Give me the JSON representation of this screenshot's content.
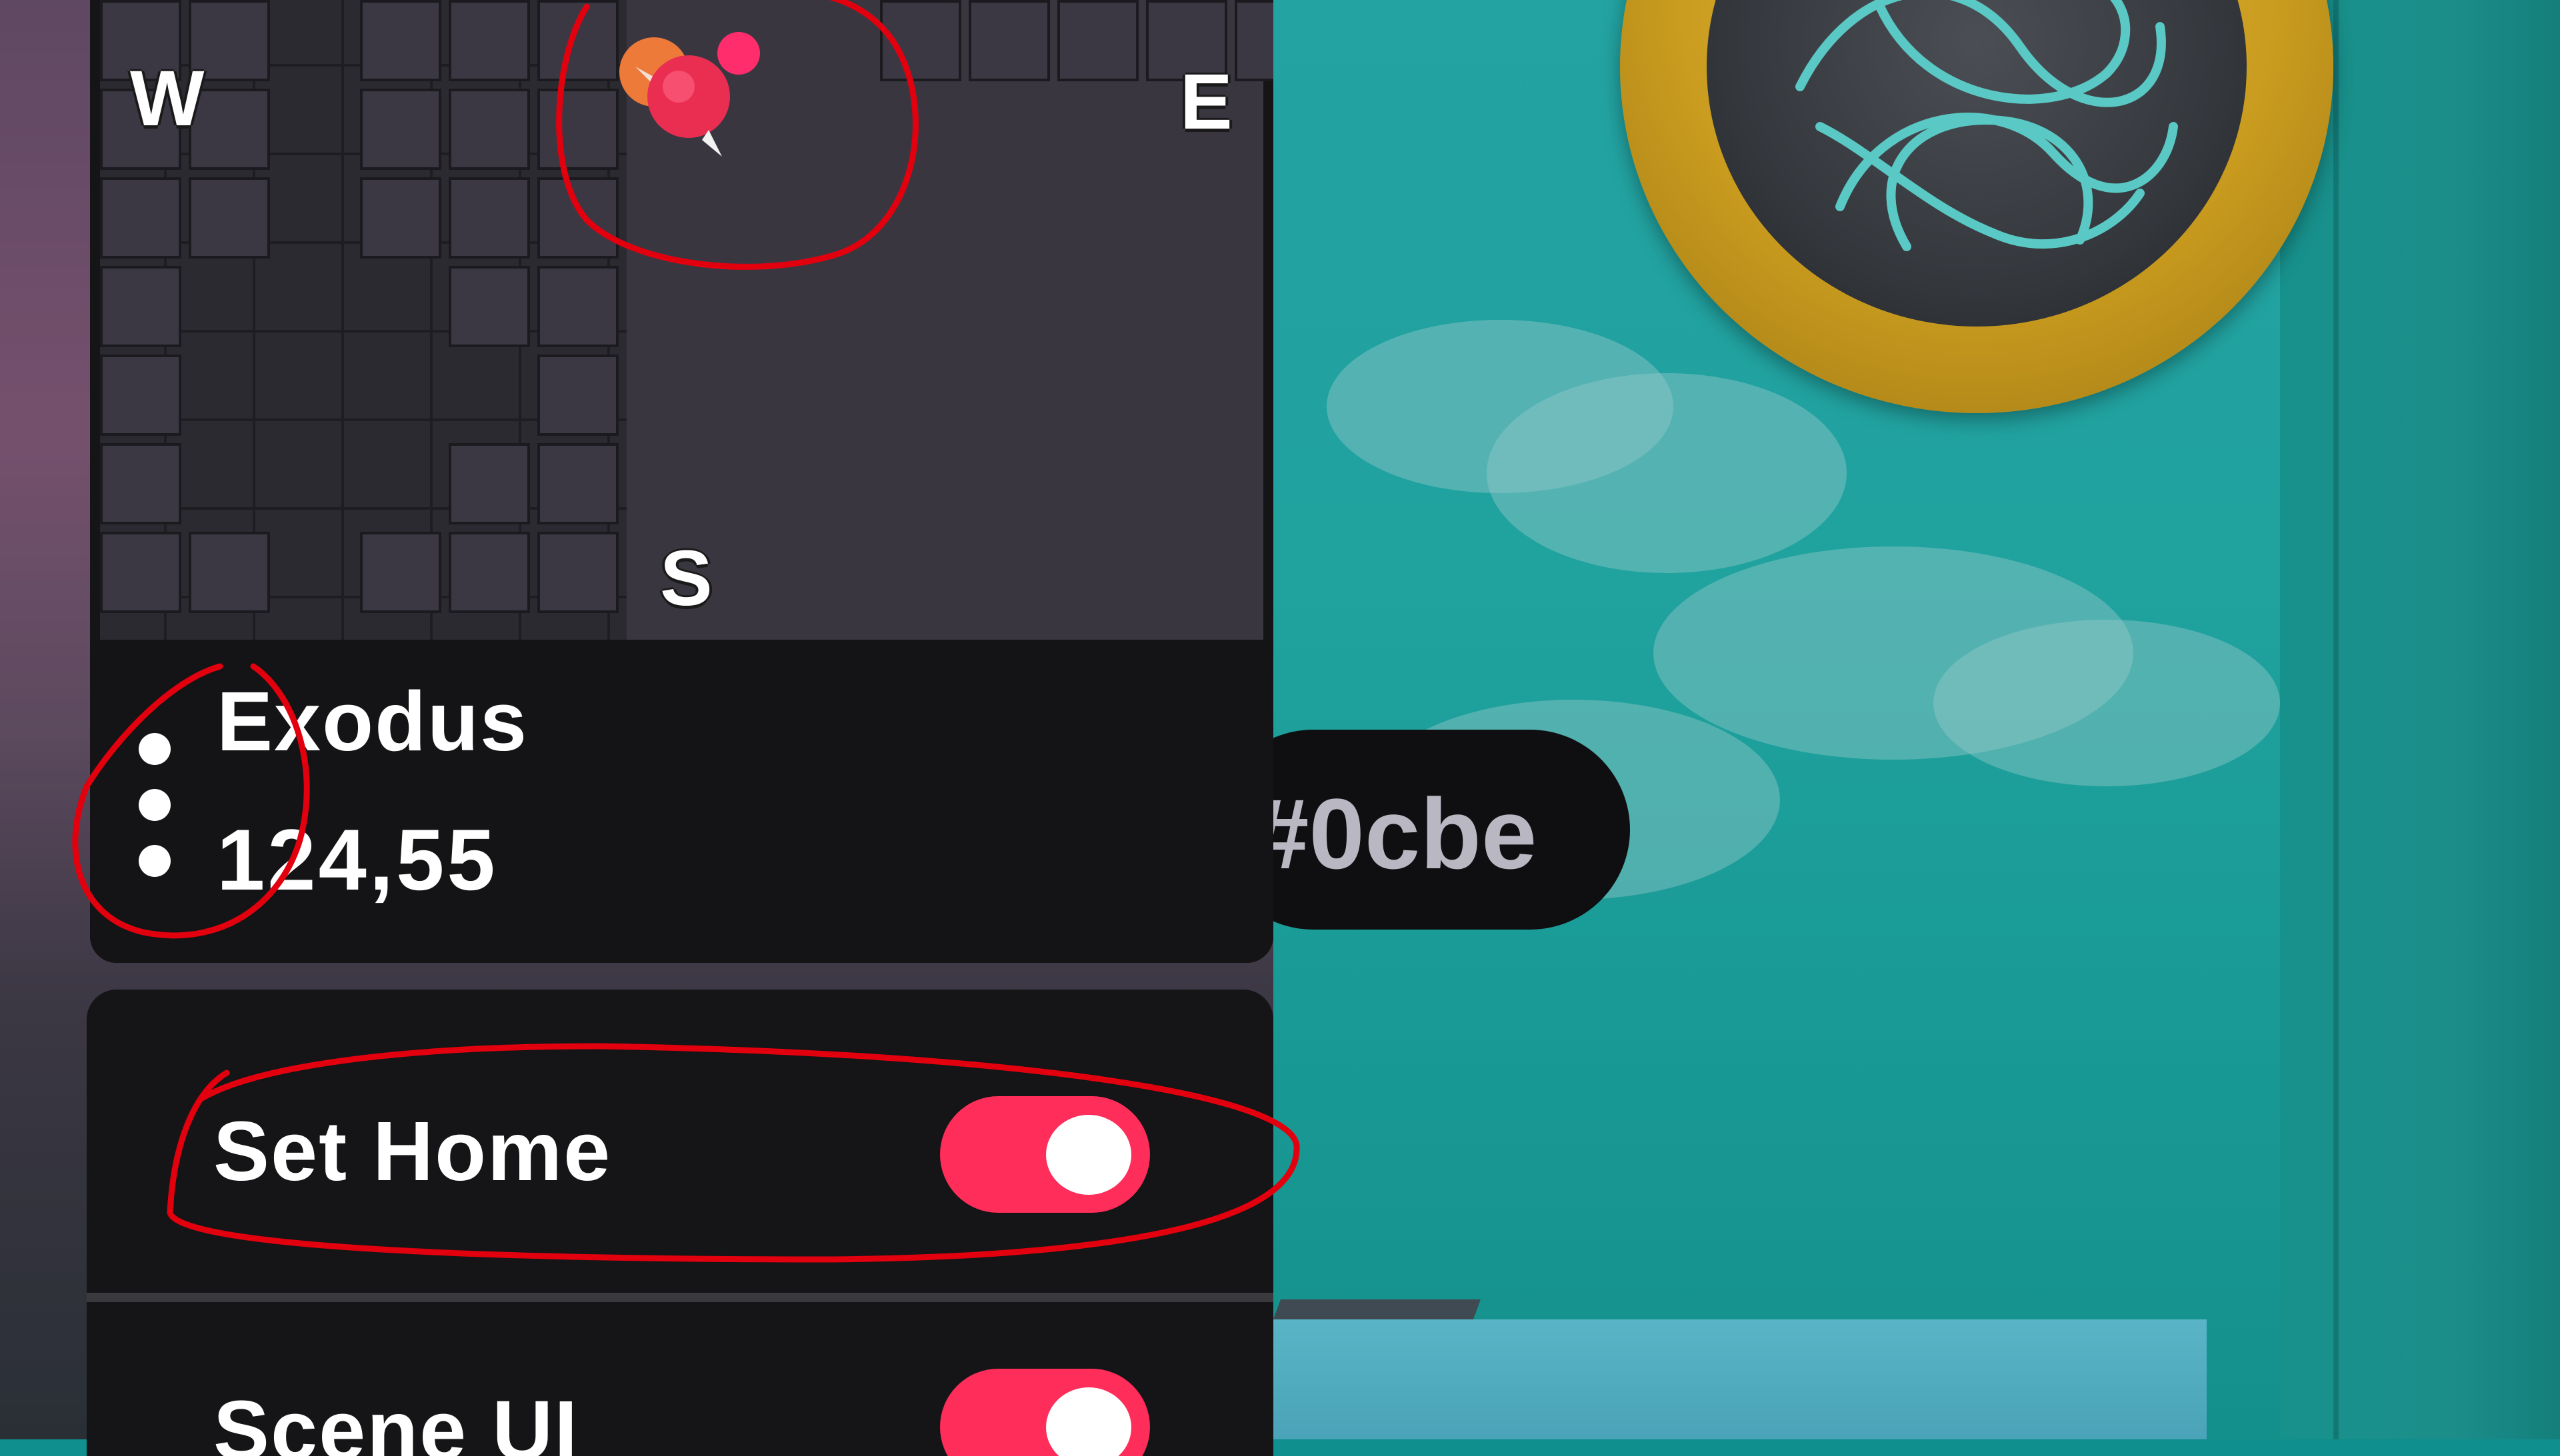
{
  "minimap": {
    "compass": {
      "west": "W",
      "east": "E",
      "south": "S"
    },
    "location_name": "Exodus",
    "location_coords": "124,55",
    "menu_icon": "more-vertical-icon",
    "player_marker_icon": "player-location-icon"
  },
  "address_pill": {
    "text": "#0cbe"
  },
  "settings": {
    "items": [
      {
        "label": "Set Home",
        "enabled": true
      },
      {
        "label": "Scene UI",
        "enabled": true
      }
    ]
  },
  "colors": {
    "accent": "#ff2d5a",
    "panel": "#151416",
    "annotation": "#e2000e"
  }
}
